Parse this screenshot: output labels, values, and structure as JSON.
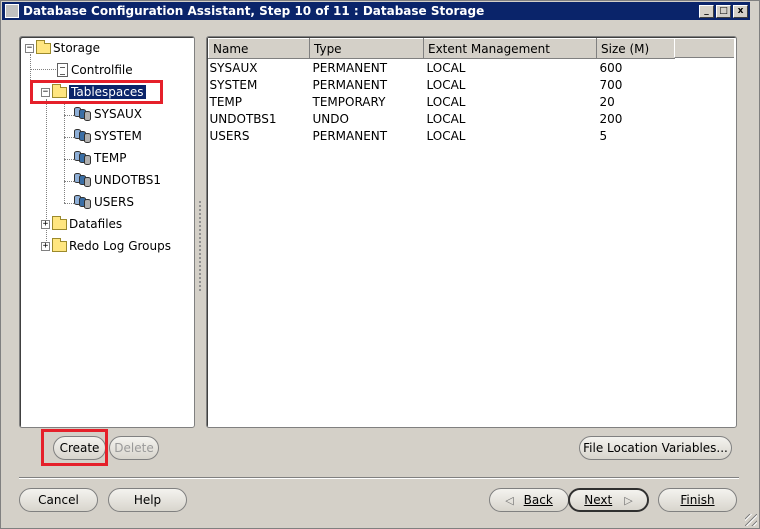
{
  "window": {
    "title": "Database Configuration Assistant, Step 10 of 11 : Database Storage",
    "controls": {
      "minimize": "_",
      "maximize": "□",
      "close": "x"
    }
  },
  "tree": {
    "root": "Storage",
    "controlfile": "Controlfile",
    "tablespaces": "Tablespaces",
    "tablespace_items": [
      "SYSAUX",
      "SYSTEM",
      "TEMP",
      "UNDOTBS1",
      "USERS"
    ],
    "datafiles": "Datafiles",
    "redo_log_groups": "Redo Log Groups",
    "expander_collapse": "−",
    "expander_expand": "+"
  },
  "table": {
    "columns": [
      "Name",
      "Type",
      "Extent Management",
      "Size (M)"
    ],
    "rows": [
      [
        "SYSAUX",
        "PERMANENT",
        "LOCAL",
        "600"
      ],
      [
        "SYSTEM",
        "PERMANENT",
        "LOCAL",
        "700"
      ],
      [
        "TEMP",
        "TEMPORARY",
        "LOCAL",
        "20"
      ],
      [
        "UNDOTBS1",
        "UNDO",
        "LOCAL",
        "200"
      ],
      [
        "USERS",
        "PERMANENT",
        "LOCAL",
        "5"
      ]
    ]
  },
  "buttons": {
    "create": "Create",
    "delete": "Delete",
    "file_location_variables": "File Location Variables...",
    "cancel": "Cancel",
    "help": "Help",
    "back": "Back",
    "next": "Next",
    "finish": "Finish",
    "back_arrow": "◁",
    "next_arrow": "▷"
  },
  "colors": {
    "titlebar": "#0a246a",
    "highlight_box": "#e5202a",
    "selection": "#0a246a"
  }
}
